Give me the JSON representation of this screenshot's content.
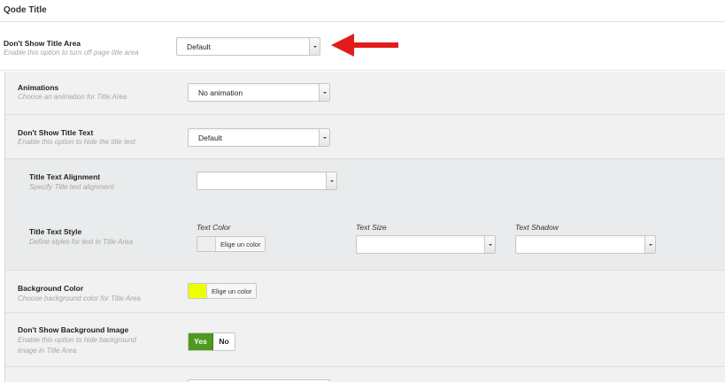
{
  "panel": {
    "title": "Qode Title"
  },
  "title_area": {
    "label": "Don't Show Title Area",
    "desc": "Enable this option to turn off page title area",
    "value": "Default"
  },
  "animations": {
    "label": "Animations",
    "desc": "Choose an animation for Title Area",
    "value": "No animation"
  },
  "title_text": {
    "label": "Don't Show Title Text",
    "desc": "Enable this option to hide the title text",
    "value": "Default"
  },
  "alignment": {
    "label": "Title Text Alignment",
    "desc": "Specify Title text alignment",
    "value": ""
  },
  "text_style": {
    "label": "Title Text Style",
    "desc": "Define styles for text in Title Area",
    "color_header": "Text Color",
    "color_button": "Elige un color",
    "size_header": "Text Size",
    "size_value": "",
    "shadow_header": "Text Shadow",
    "shadow_value": ""
  },
  "bg_color": {
    "label": "Background Color",
    "desc": "Choose background color for Title Area",
    "button": "Elige un color",
    "swatch": "#eeff00"
  },
  "bg_image": {
    "label": "Don't Show Background Image",
    "desc_line1": "Enable this option to hide background",
    "desc_line2": "image in Title Area",
    "yes": "Yes",
    "no": "No"
  },
  "colors": {
    "arrow": "#e41b1b",
    "yes_green": "#4e9a1f",
    "nested1": "#f1f1f1",
    "nested2": "#e9ebec"
  },
  "icons": {
    "arrow": "red-arrow-left-icon",
    "caret": "caret-down-icon"
  }
}
